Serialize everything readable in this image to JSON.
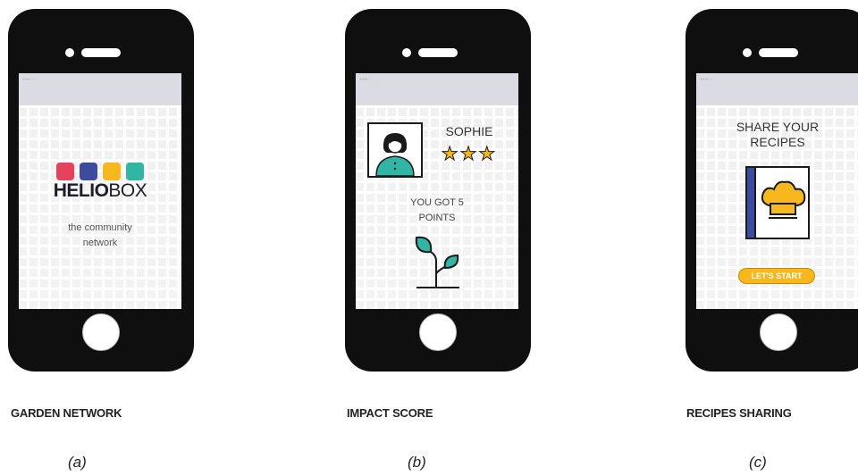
{
  "panels": [
    {
      "caption": "GARDEN NETWORK",
      "sublabel": "(a)",
      "screen": {
        "brand_bold": "HELIO",
        "brand_light": "BOX",
        "tagline_line1": "the community",
        "tagline_line2": "network",
        "logo_colors": [
          "#e5435d",
          "#3d4b9e",
          "#f6b81d",
          "#33b5a6"
        ]
      }
    },
    {
      "caption": "IMPACT SCORE",
      "sublabel": "(b)",
      "screen": {
        "user_name": "SOPHIE",
        "rating_stars": 3,
        "points_line1": "YOU GOT 5",
        "points_line2": "POINTS",
        "icons": [
          "avatar-icon",
          "star-icon",
          "sprout-icon"
        ]
      }
    },
    {
      "caption": "RECIPES SHARING",
      "sublabel": "(c)",
      "screen": {
        "title_line1": "SHARE YOUR",
        "title_line2": "RECIPES",
        "start_button": "LET'S START",
        "icons": [
          "recipe-book-icon",
          "chef-hat-icon"
        ]
      }
    }
  ],
  "colors": {
    "phone_body": "#0f0f0f",
    "accent_yellow": "#f6b81d",
    "accent_teal": "#33b5a6",
    "accent_navy": "#3d4b9e",
    "accent_red": "#e5435d"
  }
}
